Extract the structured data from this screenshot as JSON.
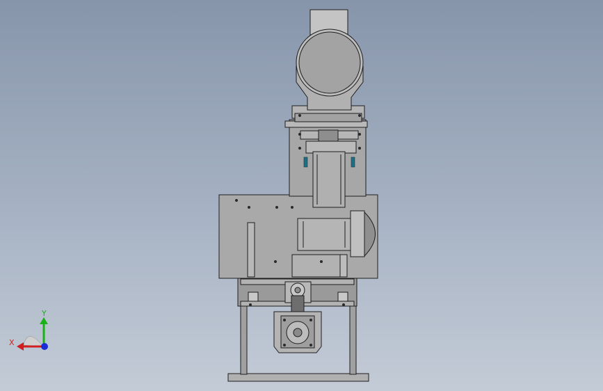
{
  "viewport": {
    "colors": {
      "bg_top": "#8795ab",
      "bg_bottom": "#c3cbd6",
      "part": "#a5a5a5",
      "part_dark": "#7d7d7d",
      "edge": "#1e1e1e"
    }
  },
  "triad": {
    "x_label": "X",
    "y_label": "Y",
    "colors": {
      "x": "#d11f1f",
      "y": "#19b019",
      "z": "#1a2ed6"
    }
  }
}
